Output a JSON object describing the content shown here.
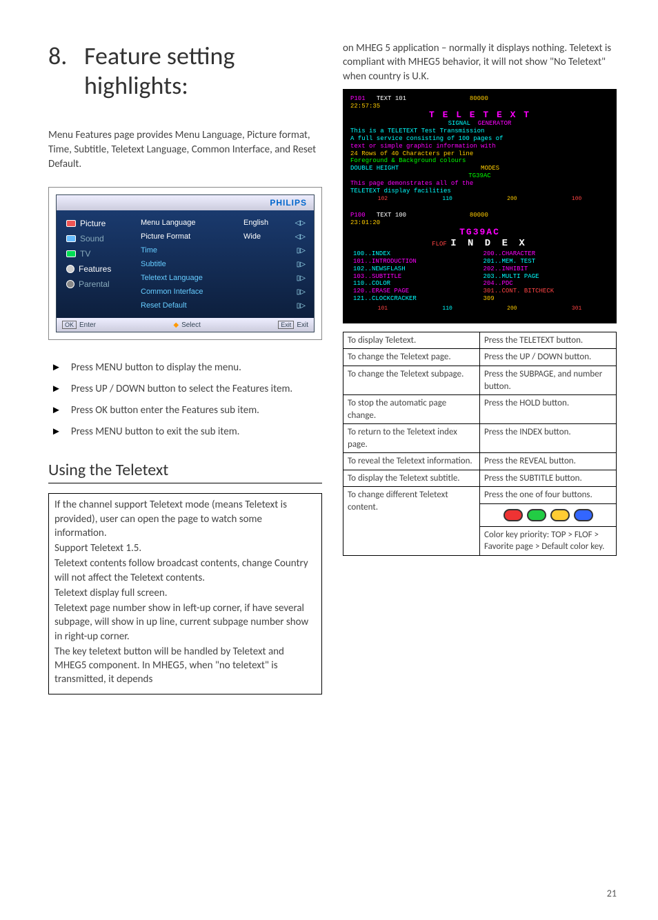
{
  "heading_number": "8.",
  "heading_text": "Feature setting highlights:",
  "intro": "Menu Features page provides Menu Language, Picture format, Time, Subtitle, Teletext Language, Common Interface, and Reset Default.",
  "menu": {
    "brand": "PHILIPS",
    "side": [
      {
        "label": "Picture"
      },
      {
        "label": "Sound"
      },
      {
        "label": "TV"
      },
      {
        "label": "Features"
      },
      {
        "label": "Parental"
      }
    ],
    "rows": [
      {
        "label": "Menu Language",
        "value": "English",
        "arrow": "◁▷"
      },
      {
        "label": "Picture Format",
        "value": "Wide",
        "arrow": "◁▷"
      },
      {
        "label": "Time",
        "value": "",
        "arrow": "▯▷"
      },
      {
        "label": "Subtitle",
        "value": "",
        "arrow": "▯▷"
      },
      {
        "label": "Teletext Language",
        "value": "",
        "arrow": "▯▷"
      },
      {
        "label": "Common Interface",
        "value": "",
        "arrow": "▯▷"
      },
      {
        "label": "Reset Default",
        "value": "",
        "arrow": "▯▷"
      }
    ],
    "footer": {
      "ok_box": "OK",
      "ok_label": "Enter",
      "select_label": "Select",
      "exit_box": "Exit",
      "exit_label": "Exit"
    }
  },
  "steps": [
    "Press MENU button to display the menu.",
    "Press UP / DOWN button to select the Features item.",
    "Press OK button enter the Features sub item.",
    "Press MENU button to exit the sub item."
  ],
  "sub_heading": "Using the Teletext",
  "box_paragraphs": [
    "If the channel support Teletext mode (means Teletext is provided), user can open the page to watch some information.",
    "Support Teletext 1.5.",
    "Teletext contents follow broadcast contents, change Country will not affect the Teletext contents.",
    "Teletext display full screen.",
    "Teletext page number show in left-up corner, if have several subpage, will show in up line, current subpage number show in right-up corner.",
    "The key teletext button will be handled by Teletext and MHEG5 component. In MHEG5, when \"no teletext\" is transmitted, it depends"
  ],
  "rc_top": "on MHEG 5 application – normally it displays nothing. Teletext is compliant with MHEG5 behavior, it will not show \"No Teletext\" when country is U.K.",
  "ttx": {
    "s1": {
      "pnum": "P101",
      "hdr": "TEXT 101",
      "time": "80000\n22:57:35",
      "title": "T E L E T E X T",
      "sig1": "SIGNAL",
      "sig2": "GENERATOR",
      "desc1": "This is a TELETEXT Test Transmission",
      "desc2": "A full service consisting of 100 pages of",
      "desc3": "text or simple graphic information with",
      "desc4": "24 Rows of 40 Characters per line",
      "desc5": "Foreground & Background colours",
      "dh": "DOUBLE HEIGHT",
      "modes": "MODES",
      "tg": "TG39AC",
      "demo": "This page demonstrates all of the",
      "demo2": "TELETEXT display facilities",
      "f1": "102",
      "f2": "110",
      "f3": "200",
      "f4": "100"
    },
    "s2": {
      "pnum": "P100",
      "hdr": "TEXT 100",
      "time": "80000\n23:01:20",
      "title": "TG39AC",
      "idx": "I N D E X",
      "flof": "FLOF",
      "left": [
        "100..INDEX",
        "101..INTRODUCTION",
        "102..NEWSFLASH",
        "103..SUBTITLE",
        "110..COLOR",
        "120..ERASE PAGE",
        "121..CLOCKCRACKER"
      ],
      "right": [
        "200..CHARACTER",
        "201..MEM. TEST",
        "202..INHIBIT",
        "203..MULTI PAGE",
        "204..PDC",
        "301..CONT. BITCHECK",
        "309"
      ],
      "f1": "101",
      "f2": "110",
      "f3": "200",
      "f4": "301"
    }
  },
  "table": [
    {
      "l": "To display Teletext.",
      "r": "Press the TELETEXT button."
    },
    {
      "l": "To change the Teletext page.",
      "r": "Press the UP / DOWN button."
    },
    {
      "l": "To change the Teletext subpage.",
      "r": "Press the SUBPAGE, and number button."
    },
    {
      "l": "To stop the automatic page change.",
      "r": "Press the HOLD button."
    },
    {
      "l": "To return to the Teletext index page.",
      "r": "Press the INDEX button."
    },
    {
      "l": "To reveal the Teletext information.",
      "r": "Press the REVEAL button."
    },
    {
      "l": "To display the Teletext subtitle.",
      "r": "Press the SUBTITLE button."
    },
    {
      "l": "To change different Teletext content.",
      "r": "Press the one of four buttons."
    }
  ],
  "color_priority": "Color key priority: TOP > FLOF > Favorite page > Default color key.",
  "page_number": "21"
}
